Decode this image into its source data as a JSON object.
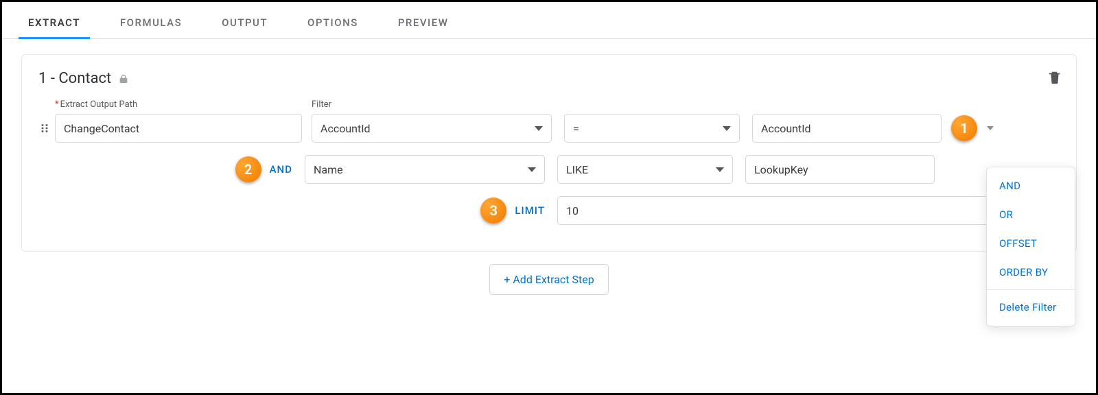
{
  "tabs": [
    "EXTRACT",
    "FORMULAS",
    "OUTPUT",
    "OPTIONS",
    "PREVIEW"
  ],
  "active_tab_index": 0,
  "step": {
    "title": "1 - Contact",
    "labels": {
      "extract_output_path": "Extract Output Path",
      "filter": "Filter"
    },
    "extract_output_path": "ChangeContact",
    "filters": [
      {
        "joiner": null,
        "field": "AccountId",
        "operator": "=",
        "value": "AccountId"
      },
      {
        "joiner": "AND",
        "field": "Name",
        "operator": "LIKE",
        "value": "LookupKey"
      }
    ],
    "limit": {
      "label": "LIMIT",
      "value": "10"
    }
  },
  "filter_menu": {
    "items": [
      "AND",
      "OR",
      "OFFSET",
      "ORDER BY"
    ],
    "delete_label": "Delete Filter"
  },
  "add_step_label": "+ Add Extract Step",
  "callouts": {
    "c1": "1",
    "c2": "2",
    "c3": "3"
  }
}
